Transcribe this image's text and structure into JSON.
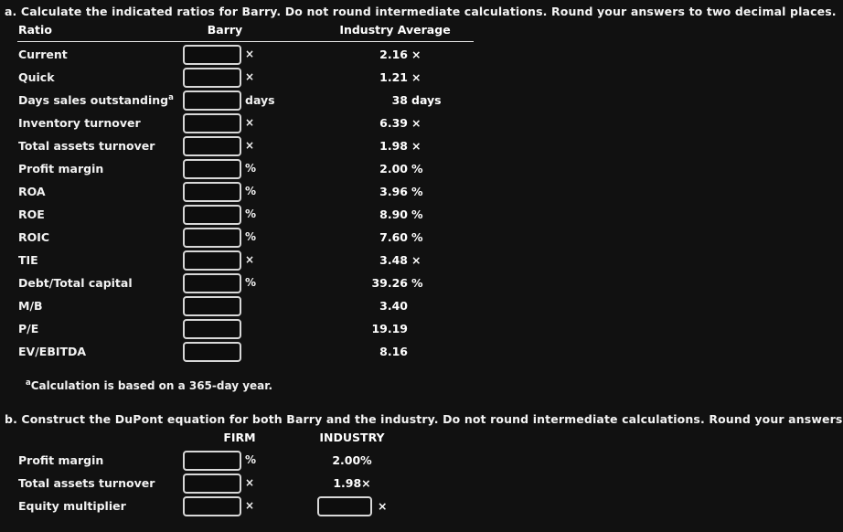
{
  "part_a": {
    "prompt": "a. Calculate the indicated ratios for Barry. Do not round intermediate calculations. Round your answers to two decimal places.",
    "columns": {
      "ratio": "Ratio",
      "barry": "Barry",
      "industry": "Industry Average"
    },
    "input_placeholder": "",
    "rows": [
      {
        "label": "Current",
        "label_sup": "",
        "value": "",
        "unit": "×",
        "industry_value": "2.16",
        "industry_unit": "×"
      },
      {
        "label": "Quick",
        "label_sup": "",
        "value": "",
        "unit": "×",
        "industry_value": "1.21",
        "industry_unit": "×"
      },
      {
        "label": "Days sales outstanding",
        "label_sup": "a",
        "value": "",
        "unit": "days",
        "industry_value": "38",
        "industry_unit": "days"
      },
      {
        "label": "Inventory turnover",
        "label_sup": "",
        "value": "",
        "unit": "×",
        "industry_value": "6.39",
        "industry_unit": "×"
      },
      {
        "label": "Total assets turnover",
        "label_sup": "",
        "value": "",
        "unit": "×",
        "industry_value": "1.98",
        "industry_unit": "×"
      },
      {
        "label": "Profit margin",
        "label_sup": "",
        "value": "",
        "unit": "%",
        "industry_value": "2.00",
        "industry_unit": "%"
      },
      {
        "label": "ROA",
        "label_sup": "",
        "value": "",
        "unit": "%",
        "industry_value": "3.96",
        "industry_unit": "%"
      },
      {
        "label": "ROE",
        "label_sup": "",
        "value": "",
        "unit": "%",
        "industry_value": "8.90",
        "industry_unit": "%"
      },
      {
        "label": "ROIC",
        "label_sup": "",
        "value": "",
        "unit": "%",
        "industry_value": "7.60",
        "industry_unit": "%"
      },
      {
        "label": "TIE",
        "label_sup": "",
        "value": "",
        "unit": "×",
        "industry_value": "3.48",
        "industry_unit": "×"
      },
      {
        "label": "Debt/Total capital",
        "label_sup": "",
        "value": "",
        "unit": "%",
        "industry_value": "39.26",
        "industry_unit": "%"
      },
      {
        "label": "M/B",
        "label_sup": "",
        "value": "",
        "unit": "",
        "industry_value": "3.40",
        "industry_unit": ""
      },
      {
        "label": "P/E",
        "label_sup": "",
        "value": "",
        "unit": "",
        "industry_value": "19.19",
        "industry_unit": ""
      },
      {
        "label": "EV/EBITDA",
        "label_sup": "",
        "value": "",
        "unit": "",
        "industry_value": "8.16",
        "industry_unit": ""
      }
    ],
    "footnote_marker": "a",
    "footnote": "Calculation is based on a 365-day year."
  },
  "part_b": {
    "prompt": "b. Construct the DuPont equation for both Barry and the industry. Do not round intermediate calculations. Round your answers to two decimal places.",
    "columns": {
      "firm": "FIRM",
      "industry": "INDUSTRY"
    },
    "input_placeholder": "",
    "rows": [
      {
        "label": "Profit margin",
        "value": "",
        "unit": "%",
        "industry_value": "2.00%",
        "industry_is_input": false,
        "industry_input_value": "",
        "industry_input_unit": ""
      },
      {
        "label": "Total assets turnover",
        "value": "",
        "unit": "×",
        "industry_value": "1.98×",
        "industry_is_input": false,
        "industry_input_value": "",
        "industry_input_unit": ""
      },
      {
        "label": "Equity multiplier",
        "value": "",
        "unit": "×",
        "industry_value": "",
        "industry_is_input": true,
        "industry_input_value": "",
        "industry_input_unit": "×"
      }
    ]
  },
  "colors": {
    "background": "#111111",
    "text": "#f2f2f2",
    "input_border": "#d8d8d8",
    "rule": "#e8e8e8"
  }
}
